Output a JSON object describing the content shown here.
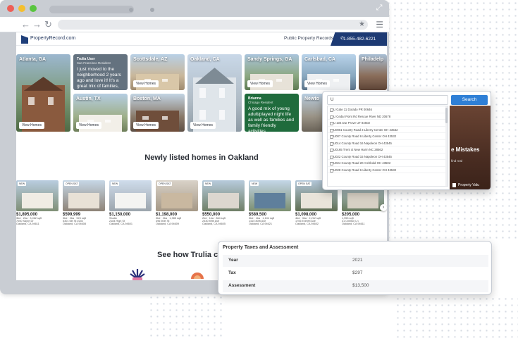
{
  "site": {
    "logo_text": "PropertyRecord.com",
    "header_link": "Public Property Records",
    "phone": "1-855-482-6221"
  },
  "cities": [
    "Atlanta, GA",
    "Scottsdale, AZ",
    "Oakland, CA",
    "Sandy Springs, GA",
    "Carlsbad, CA",
    "Philadelp",
    "Austin, TX",
    "Boston, MA",
    "Newto"
  ],
  "view_homes_label": "View Homes",
  "quotes": [
    {
      "name": "Trulia User",
      "role": "San Francisco Resident",
      "text": "I just moved to the neighborhood 2 years ago and love it! It's a great mix of families, seniors and..."
    },
    {
      "name": "Brianna",
      "role": "Chicago Resident",
      "text": "A good mix of young adult/played night life as well as families and family friendly activities..."
    }
  ],
  "listings_title": "Newly listed homes in Oakland",
  "listings": [
    {
      "badge": "NEW",
      "price": "$1,895,000",
      "specs": "3bd · 2ba · 3,062 sqft",
      "addr": "7050 Sayre Dr",
      "city": "Oakland, CA 94611"
    },
    {
      "badge": "OPEN SAT",
      "price": "$599,999",
      "specs": "3bd · 2ba · 923 sqft",
      "addr": "5301 6th St #202",
      "city": "Oakland, CA 94608"
    },
    {
      "badge": "NEW",
      "price": "$1,150,000",
      "specs": "Studio",
      "addr": "2184 High St",
      "city": "Oakland, CA 94601"
    },
    {
      "badge": "OPEN SAT",
      "price": "$1,198,000",
      "specs": "3bd · 2ba · 1,985 sqft",
      "addr": "496 50th St",
      "city": "Oakland, CA 94609"
    },
    {
      "badge": "NEW",
      "price": "$550,000",
      "specs": "2bd · 1ba · 864 sqft",
      "addr": "2330 89th Ave",
      "city": "Oakland, CA 94605"
    },
    {
      "badge": "NEW",
      "price": "$589,500",
      "specs": "3bd · 1ba · 1,104 sqft",
      "addr": "1410 80th Ave",
      "city": "Oakland, CA 94621"
    },
    {
      "badge": "OPEN SAT",
      "price": "$1,098,000",
      "specs": "4bd · 3ba · 2,212 sqft",
      "addr": "1706 Everett Ave",
      "city": "Oakland, CA 94602"
    },
    {
      "badge": "NEW",
      "price": "$205,000",
      "specs": "1,953 sqft",
      "addr": "41 Chelton Ln",
      "city": "Oakland, CA 94611"
    }
  ],
  "trulia_title": "See how Trulia co",
  "search": {
    "query": "U",
    "button": "Search",
    "suggestions": [
      "U Gate 11 Dorado PR 00646",
      "U Cedar Point Rd Rescue River ND 20678",
      "U 104 Dur Prove UT 84502",
      "U0061 County Road 3 Liberty Center OH 43532",
      "U007 County Road 6 Liberty Center OH 43532",
      "U014 County Road 16 Napoleon OH 43545",
      "U0165 Trent ct New Harm NC 28562",
      "U022 County Road 15 Napoleon OH 43545",
      "U024 County Road 20 Archbold OH 43502",
      "U028 County Road 6 Liberty Center OH 43532"
    ]
  },
  "promo": {
    "headline": "e Mistakes",
    "sub": "find real",
    "value_label": "Property Valu"
  },
  "tax": {
    "title": "Property Taxes and Assessment",
    "rows": [
      {
        "label": "Year",
        "value": "2021"
      },
      {
        "label": "Tax",
        "value": "$297"
      },
      {
        "label": "Assessment",
        "value": "$13,500"
      }
    ]
  },
  "colors": {
    "brand_navy": "#1d3a73",
    "search_blue": "#2e7fd6",
    "quote_grey": "#64727f",
    "quote_green": "#1f6b3c"
  }
}
